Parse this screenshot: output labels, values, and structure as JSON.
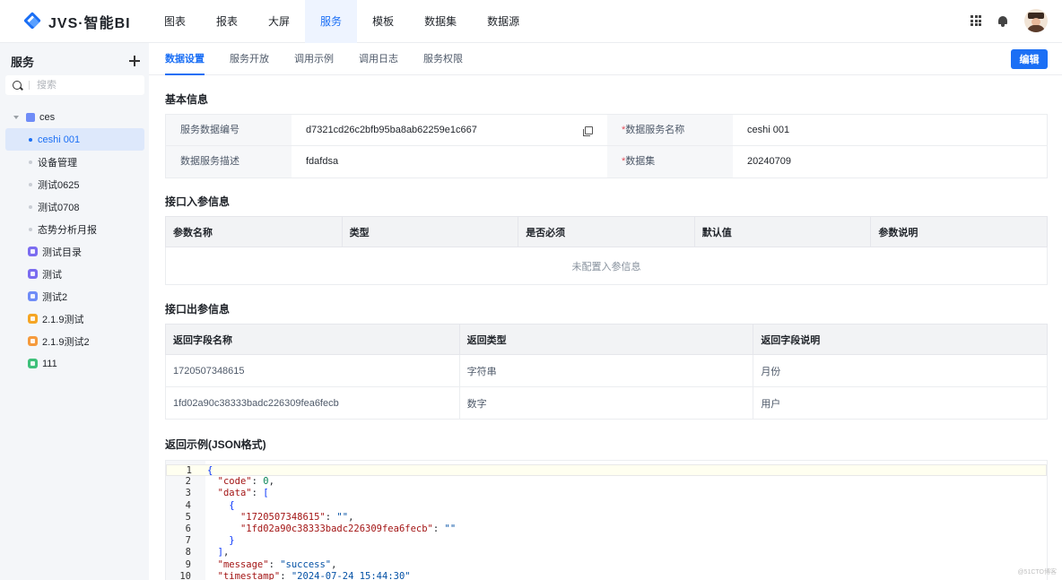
{
  "app": {
    "logo_text": "JVS·智能BI"
  },
  "topnav": [
    {
      "label": "图表"
    },
    {
      "label": "报表"
    },
    {
      "label": "大屏"
    },
    {
      "label": "服务",
      "active": true
    },
    {
      "label": "模板"
    },
    {
      "label": "数据集"
    },
    {
      "label": "数据源"
    }
  ],
  "sidebar": {
    "title": "服务",
    "search_placeholder": "搜索",
    "tree": [
      {
        "label": "ces",
        "kind": "folder-root",
        "color": "#6f8cf7"
      },
      {
        "label": "ceshi 001",
        "kind": "leaf",
        "active": true
      },
      {
        "label": "设备管理",
        "kind": "leaf"
      },
      {
        "label": "测试0625",
        "kind": "leaf"
      },
      {
        "label": "测试0708",
        "kind": "leaf"
      },
      {
        "label": "态势分析月报",
        "kind": "leaf"
      },
      {
        "label": "测试目录",
        "kind": "folder",
        "color": "#7b6cf0"
      },
      {
        "label": "测试",
        "kind": "folder",
        "color": "#7b6cf0"
      },
      {
        "label": "测试2",
        "kind": "folder",
        "color": "#6f8cf7"
      },
      {
        "label": "2.1.9测试",
        "kind": "folder",
        "color": "#f5a524"
      },
      {
        "label": "2.1.9测试2",
        "kind": "folder",
        "color": "#f59a3c"
      },
      {
        "label": "111",
        "kind": "folder",
        "color": "#3ec07a"
      }
    ]
  },
  "subtabs": [
    {
      "label": "数据设置",
      "active": true
    },
    {
      "label": "服务开放"
    },
    {
      "label": "调用示例"
    },
    {
      "label": "调用日志"
    },
    {
      "label": "服务权限"
    }
  ],
  "edit_button": "编辑",
  "basic": {
    "title": "基本信息",
    "id_label": "服务数据编号",
    "id_value": "d7321cd26c2bfb95ba8ab62259e1c667",
    "name_label": "数据服务名称",
    "name_value": "ceshi 001",
    "desc_label": "数据服务描述",
    "desc_value": "fdafdsa",
    "dataset_label": "数据集",
    "dataset_value": "20240709",
    "required_mark": "*"
  },
  "input_params": {
    "title": "接口入参信息",
    "columns": [
      "参数名称",
      "类型",
      "是否必须",
      "默认值",
      "参数说明"
    ],
    "empty_text": "未配置入参信息"
  },
  "output_params": {
    "title": "接口出参信息",
    "columns": [
      "返回字段名称",
      "返回类型",
      "返回字段说明"
    ],
    "rows": [
      [
        "1720507348615",
        "字符串",
        "月份"
      ],
      [
        "1fd02a90c38333badc226309fea6fecb",
        "数字",
        "用户"
      ]
    ]
  },
  "example": {
    "title": "返回示例(JSON格式)",
    "lines": [
      {
        "n": "1",
        "code": "{"
      },
      {
        "n": "2",
        "code": "  \"code\": 0,"
      },
      {
        "n": "3",
        "code": "  \"data\": ["
      },
      {
        "n": "4",
        "code": "    {"
      },
      {
        "n": "5",
        "code": "      \"1720507348615\": \"\","
      },
      {
        "n": "6",
        "code": "      \"1fd02a90c38333badc226309fea6fecb\": \"\""
      },
      {
        "n": "7",
        "code": "    }"
      },
      {
        "n": "8",
        "code": "  ],"
      },
      {
        "n": "9",
        "code": "  \"message\": \"success\","
      },
      {
        "n": "10",
        "code": "  \"timestamp\": \"2024-07-24 15:44:30\""
      }
    ]
  },
  "footer_watermark": "@51CTO博客"
}
